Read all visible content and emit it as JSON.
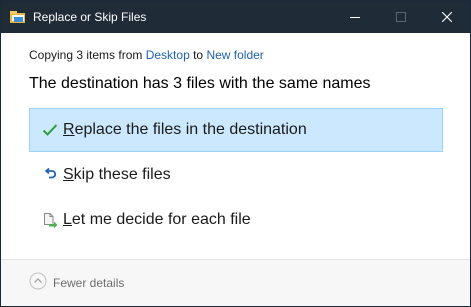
{
  "window": {
    "title": "Replace or Skip Files"
  },
  "header": {
    "copying_prefix": "Copying 3 items from ",
    "source_link": "Desktop",
    "to_word": " to ",
    "dest_link": "New folder",
    "headline": "The destination has 3 files with the same names"
  },
  "options": [
    {
      "first_letter": "R",
      "rest": "eplace the files in the destination",
      "icon": "check-icon",
      "selected": true
    },
    {
      "first_letter": "S",
      "rest": "kip these files",
      "icon": "skip-arrow-icon",
      "selected": false
    },
    {
      "first_letter": "L",
      "rest": "et me decide for each file",
      "icon": "file-decide-icon",
      "selected": false
    }
  ],
  "footer": {
    "details_label": "Fewer details"
  },
  "colors": {
    "titlebar": "#1f2b37",
    "link": "#1e63b4",
    "selected_bg": "#cce8ff",
    "selected_border": "#99d1ff",
    "check_green": "#2e9e3e",
    "skip_blue": "#1e63b4"
  }
}
